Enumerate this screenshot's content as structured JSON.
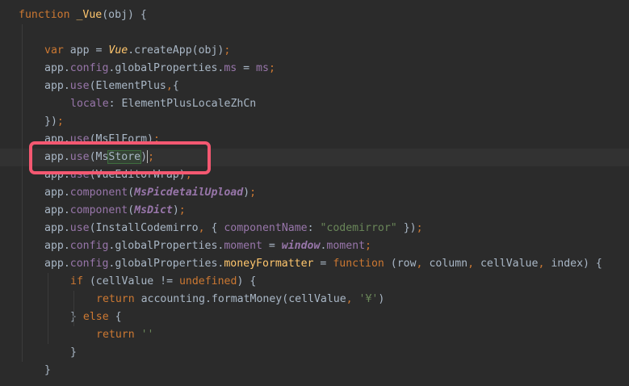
{
  "editor": {
    "lines": [
      {
        "indent": 0,
        "tokens": [
          {
            "t": "function ",
            "c": "kw"
          },
          {
            "t": "_Vue",
            "c": "fn"
          },
          {
            "t": "(obj) {",
            "c": "plain"
          }
        ]
      },
      {
        "indent": 0,
        "tokens": []
      },
      {
        "indent": 1,
        "tokens": [
          {
            "t": "var ",
            "c": "kw"
          },
          {
            "t": "app = ",
            "c": "plain"
          },
          {
            "t": "Vue",
            "c": "vue"
          },
          {
            "t": ".createApp(obj)",
            "c": "plain"
          },
          {
            "t": ";",
            "c": "kw"
          }
        ]
      },
      {
        "indent": 1,
        "tokens": [
          {
            "t": "app.",
            "c": "plain"
          },
          {
            "t": "config",
            "c": "prop"
          },
          {
            "t": ".globalProperties.",
            "c": "plain"
          },
          {
            "t": "ms",
            "c": "prop"
          },
          {
            "t": " = ",
            "c": "plain"
          },
          {
            "t": "ms",
            "c": "prop"
          },
          {
            "t": ";",
            "c": "kw"
          }
        ]
      },
      {
        "indent": 1,
        "tokens": [
          {
            "t": "app.",
            "c": "plain"
          },
          {
            "t": "use",
            "c": "prop"
          },
          {
            "t": "(ElementPlus",
            "c": "plain"
          },
          {
            "t": ",",
            "c": "kw"
          },
          {
            "t": "{",
            "c": "plain"
          }
        ]
      },
      {
        "indent": 2,
        "tokens": [
          {
            "t": "locale",
            "c": "prop"
          },
          {
            "t": ": ElementPlusLocaleZhCn",
            "c": "plain"
          }
        ]
      },
      {
        "indent": 1,
        "tokens": [
          {
            "t": "})",
            "c": "plain"
          },
          {
            "t": ";",
            "c": "kw"
          }
        ]
      },
      {
        "indent": 1,
        "tokens": [
          {
            "t": "app.",
            "c": "plain"
          },
          {
            "t": "use",
            "c": "prop"
          },
          {
            "t": "(MsElForm)",
            "c": "plain"
          },
          {
            "t": ";",
            "c": "kw"
          }
        ]
      },
      {
        "indent": 1,
        "current": true,
        "tokens": [
          {
            "t": "app.",
            "c": "plain"
          },
          {
            "t": "use",
            "c": "prop"
          },
          {
            "t": "(Ms",
            "c": "plain"
          },
          {
            "t": "Store",
            "c": "plain sel-word"
          },
          {
            "t": ")",
            "c": "plain"
          },
          {
            "t": ";",
            "c": "kw"
          }
        ]
      },
      {
        "indent": 1,
        "tokens": [
          {
            "t": "app.",
            "c": "plain"
          },
          {
            "t": "use",
            "c": "prop"
          },
          {
            "t": "(VueEditorWrap)",
            "c": "plain"
          },
          {
            "t": ";",
            "c": "kw"
          }
        ]
      },
      {
        "indent": 1,
        "tokens": [
          {
            "t": "app.",
            "c": "plain"
          },
          {
            "t": "component",
            "c": "prop"
          },
          {
            "t": "(",
            "c": "plain"
          },
          {
            "t": "MsPicdetailUpload",
            "c": "ital-purple"
          },
          {
            "t": ")",
            "c": "plain"
          },
          {
            "t": ";",
            "c": "kw"
          }
        ]
      },
      {
        "indent": 1,
        "tokens": [
          {
            "t": "app.",
            "c": "plain"
          },
          {
            "t": "component",
            "c": "prop"
          },
          {
            "t": "(",
            "c": "plain"
          },
          {
            "t": "MsDict",
            "c": "ital-purple"
          },
          {
            "t": ")",
            "c": "plain"
          },
          {
            "t": ";",
            "c": "kw"
          }
        ]
      },
      {
        "indent": 1,
        "tokens": [
          {
            "t": "app.",
            "c": "plain"
          },
          {
            "t": "use",
            "c": "prop"
          },
          {
            "t": "(InstallCodemirro",
            "c": "plain"
          },
          {
            "t": ",",
            "c": "kw"
          },
          {
            "t": " { ",
            "c": "plain"
          },
          {
            "t": "componentName",
            "c": "prop"
          },
          {
            "t": ": ",
            "c": "plain"
          },
          {
            "t": "\"codemirror\"",
            "c": "str"
          },
          {
            "t": " })",
            "c": "plain"
          },
          {
            "t": ";",
            "c": "kw"
          }
        ]
      },
      {
        "indent": 1,
        "tokens": [
          {
            "t": "app.",
            "c": "plain"
          },
          {
            "t": "config",
            "c": "prop"
          },
          {
            "t": ".globalProperties.",
            "c": "plain"
          },
          {
            "t": "moment",
            "c": "prop"
          },
          {
            "t": " = ",
            "c": "plain"
          },
          {
            "t": "window",
            "c": "ital-purple"
          },
          {
            "t": ".",
            "c": "plain"
          },
          {
            "t": "moment",
            "c": "prop"
          },
          {
            "t": ";",
            "c": "kw"
          }
        ]
      },
      {
        "indent": 1,
        "tokens": [
          {
            "t": "app.",
            "c": "plain"
          },
          {
            "t": "config",
            "c": "prop"
          },
          {
            "t": ".globalProperties.",
            "c": "plain"
          },
          {
            "t": "moneyFormatter",
            "c": "fn"
          },
          {
            "t": " = ",
            "c": "plain"
          },
          {
            "t": "function ",
            "c": "kw"
          },
          {
            "t": "(row",
            "c": "plain"
          },
          {
            "t": ", ",
            "c": "kw"
          },
          {
            "t": "column",
            "c": "plain"
          },
          {
            "t": ", ",
            "c": "kw"
          },
          {
            "t": "cellValue",
            "c": "plain"
          },
          {
            "t": ", ",
            "c": "kw"
          },
          {
            "t": "index) {",
            "c": "plain"
          }
        ]
      },
      {
        "indent": 2,
        "tokens": [
          {
            "t": "if ",
            "c": "kw"
          },
          {
            "t": "(cellValue != ",
            "c": "plain"
          },
          {
            "t": "undefined",
            "c": "kw"
          },
          {
            "t": ") {",
            "c": "plain"
          }
        ]
      },
      {
        "indent": 3,
        "tokens": [
          {
            "t": "return ",
            "c": "kw"
          },
          {
            "t": "accounting.formatMoney(cellValue",
            "c": "plain"
          },
          {
            "t": ", ",
            "c": "kw"
          },
          {
            "t": "'¥'",
            "c": "str"
          },
          {
            "t": ")",
            "c": "plain"
          }
        ]
      },
      {
        "indent": 2,
        "tokens": [
          {
            "t": "} ",
            "c": "plain"
          },
          {
            "t": "else ",
            "c": "kw"
          },
          {
            "t": "{",
            "c": "plain"
          }
        ]
      },
      {
        "indent": 3,
        "tokens": [
          {
            "t": "return ",
            "c": "kw"
          },
          {
            "t": "''",
            "c": "str"
          }
        ]
      },
      {
        "indent": 2,
        "tokens": [
          {
            "t": "}",
            "c": "plain"
          }
        ]
      },
      {
        "indent": 1,
        "tokens": [
          {
            "t": "}",
            "c": "plain"
          }
        ]
      }
    ]
  },
  "colors": {
    "background": "#2b2b2b",
    "keyword": "#cc7832",
    "function": "#ffc66d",
    "property": "#9876aa",
    "string": "#6a8759",
    "text": "#a9b7c6",
    "annotation": "#f45871"
  }
}
